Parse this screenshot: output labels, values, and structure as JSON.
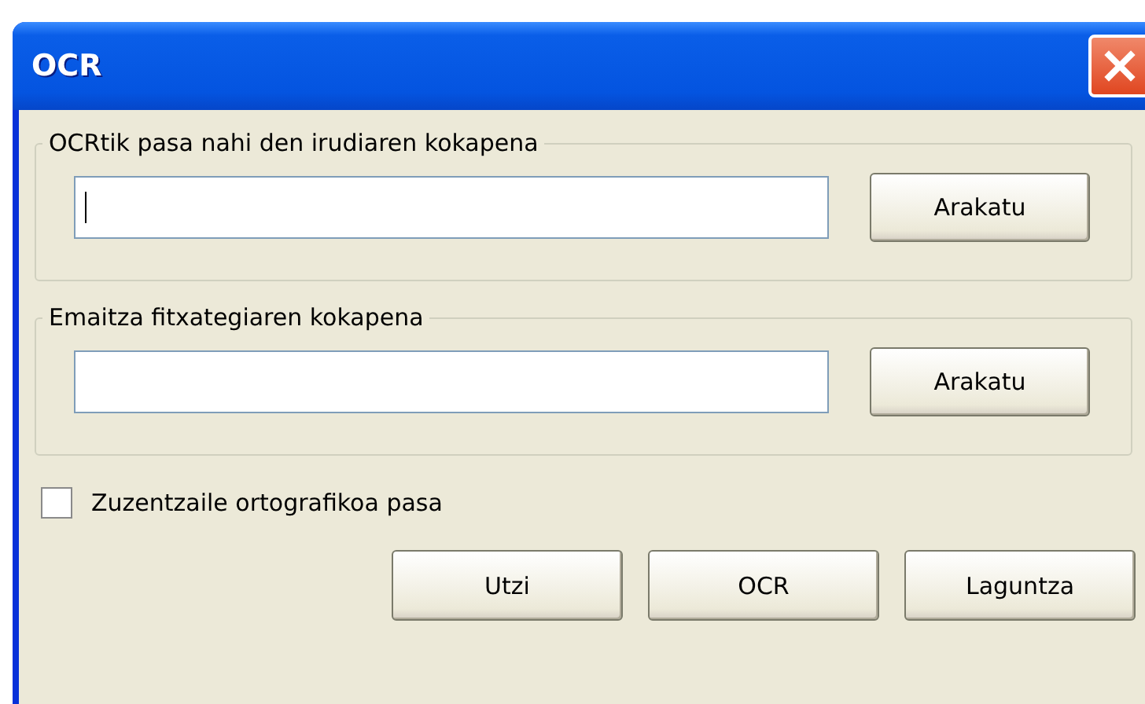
{
  "window": {
    "title": "OCR"
  },
  "groups": [
    {
      "legend": "OCRtik pasa nahi den irudiaren kokapena",
      "field": {
        "focused": true
      },
      "button": "Arakatu"
    },
    {
      "legend": "Emaitza fitxategiaren kokapena",
      "field": {
        "focused": false
      },
      "button": "Arakatu"
    }
  ],
  "checkbox": {
    "label": "Zuzentzaile ortografikoa pasa",
    "checked": false
  },
  "buttons": [
    "Utzi",
    "OCR",
    "Laguntza"
  ]
}
